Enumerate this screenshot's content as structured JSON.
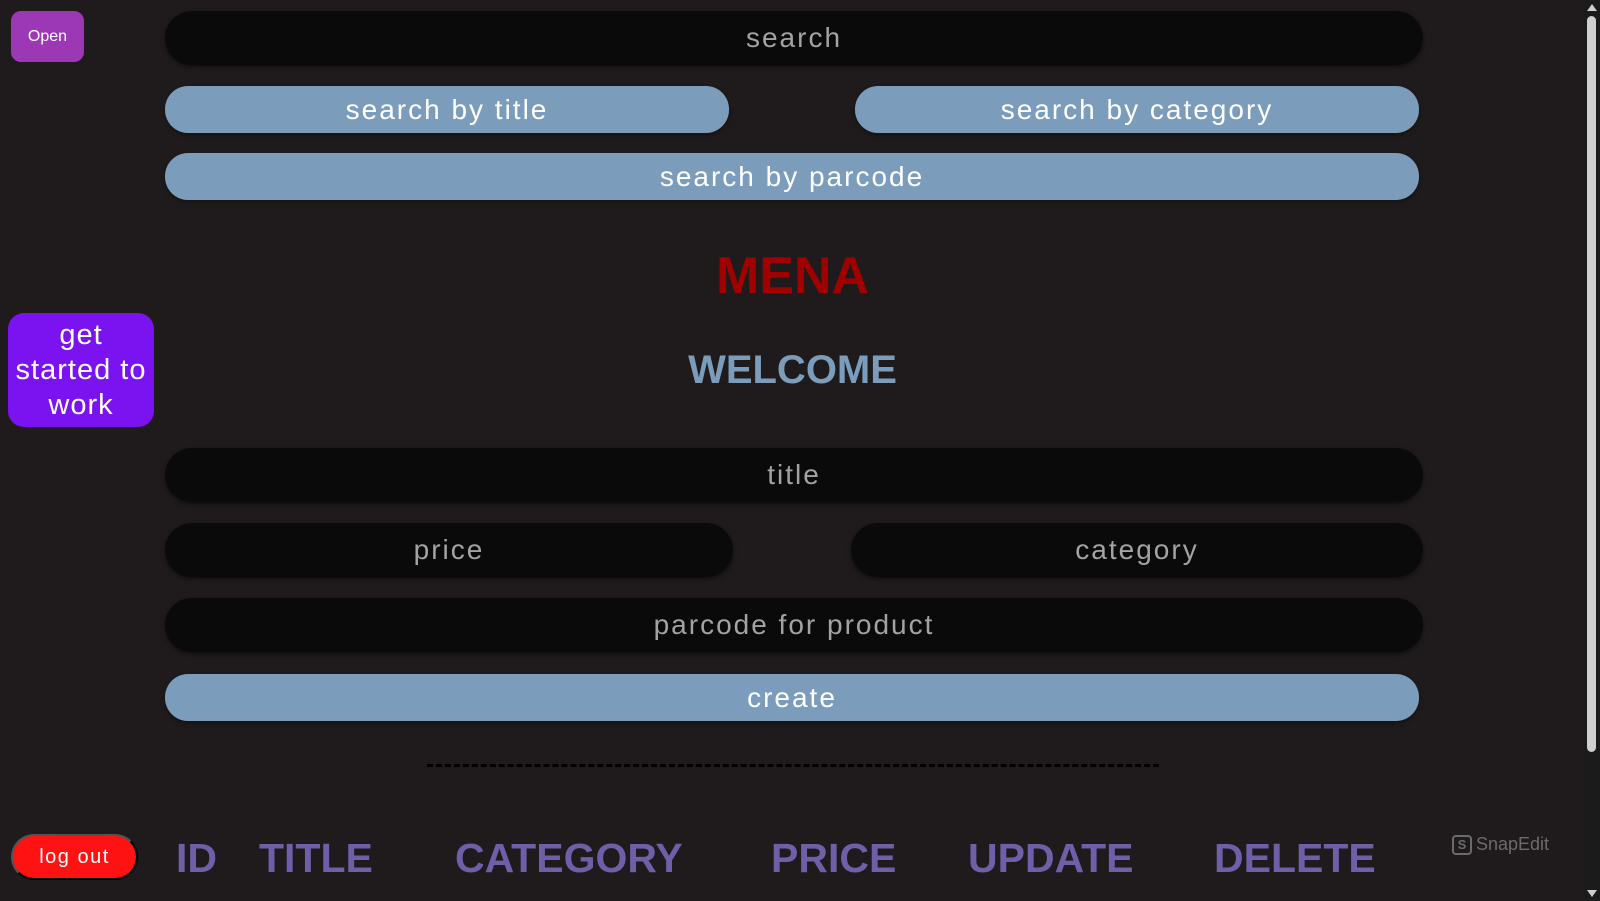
{
  "sidebar": {
    "open_label": "Open",
    "get_started_label": "get started to work",
    "logout_label": "log out"
  },
  "search": {
    "placeholder": "search",
    "by_title_label": "search by title",
    "by_category_label": "search by category",
    "by_parcode_label": "search by parcode"
  },
  "brand": {
    "title": "MENA",
    "welcome": "WELCOME"
  },
  "form": {
    "title_placeholder": "title",
    "price_placeholder": "price",
    "category_placeholder": "category",
    "parcode_placeholder": "parcode for product",
    "create_label": "create"
  },
  "table": {
    "headers": [
      "ID",
      "TITLE",
      "CATEGORY",
      "PRICE",
      "UPDATE",
      "DELETE"
    ]
  },
  "watermark": {
    "text": "SnapEdit"
  },
  "colors": {
    "background": "#1f1b1c",
    "accent_blue": "#7b9dbb",
    "brand_red": "#a00000",
    "header_purple": "#6e5fa8",
    "logout_red": "#ff1212",
    "get_started_purple": "#7b13f0",
    "open_purple": "#9c38b5"
  }
}
